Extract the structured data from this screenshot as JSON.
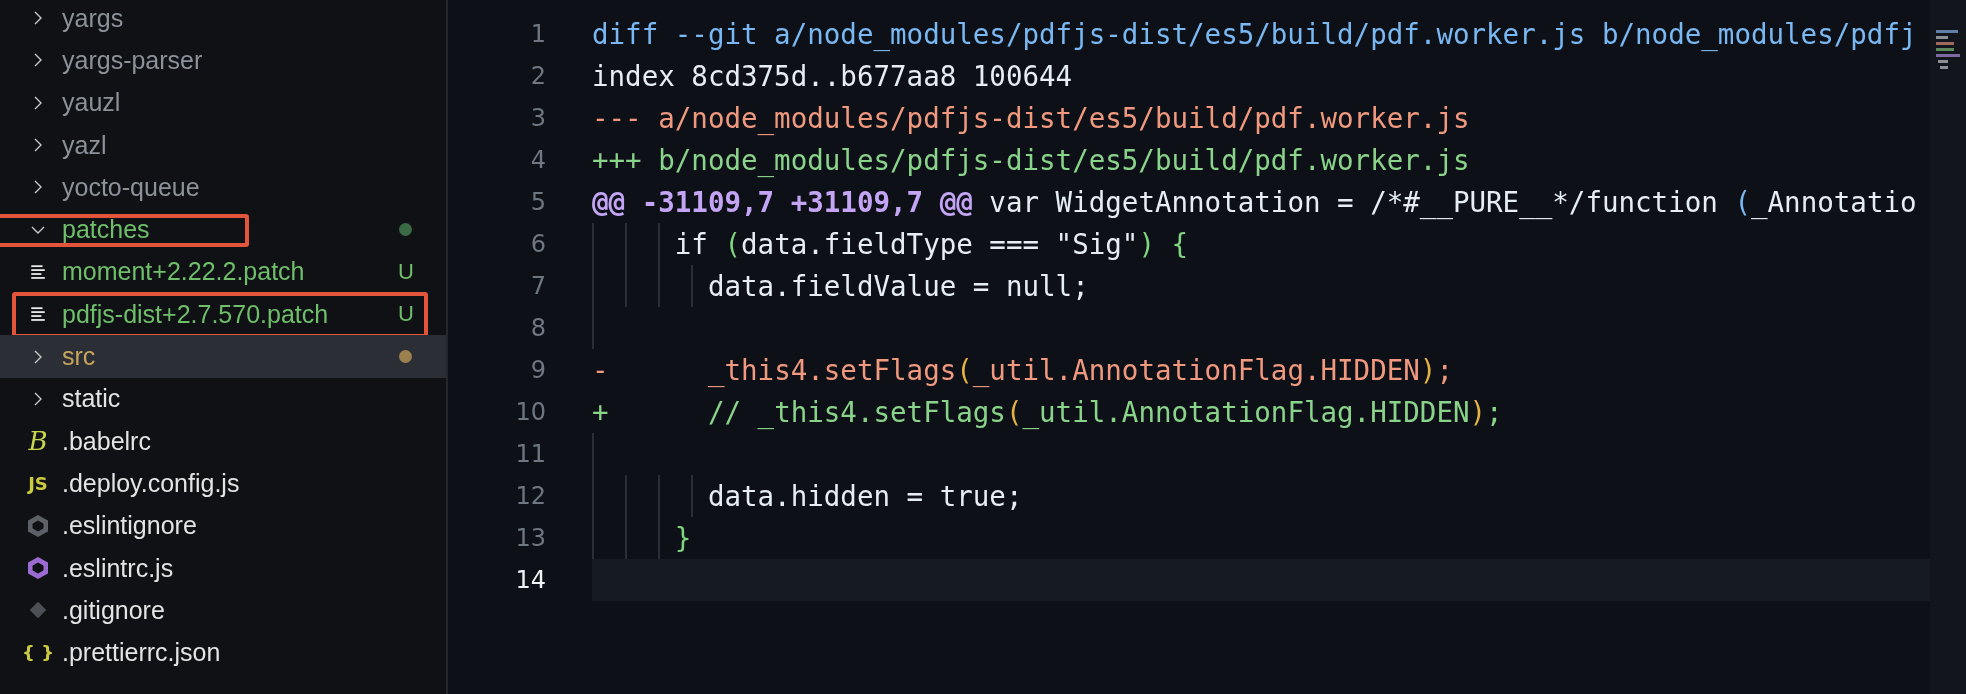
{
  "explorer": {
    "tree": [
      {
        "children": [
          {
            "label": "yargs",
            "kind": "folder",
            "expanded": false,
            "color": "#8d919a",
            "selected": false,
            "highlighted": false
          },
          {
            "label": "yargs-parser",
            "kind": "folder",
            "expanded": false,
            "color": "#8d919a",
            "selected": false,
            "highlighted": false
          },
          {
            "label": "yauzl",
            "kind": "folder",
            "expanded": false,
            "color": "#8d919a",
            "selected": false,
            "highlighted": false
          },
          {
            "label": "yazl",
            "kind": "folder",
            "expanded": false,
            "color": "#8d919a",
            "selected": false,
            "highlighted": false
          },
          {
            "label": "yocto-queue",
            "kind": "folder",
            "expanded": false,
            "color": "#8d919a",
            "selected": false,
            "highlighted": false
          }
        ]
      },
      {
        "label": "patches",
        "kind": "folder",
        "expanded": true,
        "color": "#6fbf6a",
        "dot": {
          "color": "#3b6b45"
        },
        "selected": false,
        "highlighted": true,
        "children": [
          {
            "label": "moment+2.22.2.patch",
            "kind": "file",
            "icon": {
              "kind": "lines"
            },
            "color": "#6fbf6a",
            "badge": "U",
            "selected": false,
            "highlighted": false
          },
          {
            "label": "pdfjs-dist+2.7.570.patch",
            "kind": "file",
            "icon": {
              "kind": "lines"
            },
            "color": "#6fbf6a",
            "badge": "U",
            "selected": false,
            "highlighted": true
          }
        ]
      },
      {
        "label": "src",
        "kind": "folder",
        "expanded": false,
        "color": "#c9a55c",
        "dot": {
          "color": "#9c8050"
        },
        "selected": true,
        "highlighted": false
      },
      {
        "label": "static",
        "kind": "folder",
        "expanded": false,
        "color": "#e4e4e4",
        "selected": false,
        "highlighted": false
      },
      {
        "label": ".babelrc",
        "kind": "file",
        "icon": {
          "kind": "glyph",
          "text": "B"
        },
        "color": "#e4e4e4",
        "selected": false,
        "highlighted": false
      },
      {
        "label": ".deploy.config.js",
        "kind": "file",
        "icon": {
          "kind": "glyph",
          "text": "JS"
        },
        "color": "#e4e4e4",
        "selected": false,
        "highlighted": false
      },
      {
        "label": ".eslintignore",
        "kind": "file",
        "icon": {
          "kind": "hexagon",
          "color": "#5d6167"
        },
        "color": "#e4e4e4",
        "selected": false,
        "highlighted": false
      },
      {
        "label": ".eslintrc.js",
        "kind": "file",
        "icon": {
          "kind": "hexagon",
          "color": "#9a6bd0"
        },
        "color": "#e4e4e4",
        "selected": false,
        "highlighted": false
      },
      {
        "label": ".gitignore",
        "kind": "file",
        "icon": {
          "kind": "diamond"
        },
        "color": "#e4e4e4",
        "selected": false,
        "highlighted": false
      },
      {
        "label": ".prettierrc.json",
        "kind": "file",
        "icon": {
          "kind": "glyph",
          "text": "{ }"
        },
        "color": "#e4e4e4",
        "selected": false,
        "highlighted": false
      }
    ]
  },
  "editor": {
    "lines": [
      {
        "number": "1",
        "kind": "header",
        "current": false,
        "segments": [
          {
            "text": "diff --git a/node_modules/pdfjs-dist/es5/build/pdf.worker.js b/node_modules/pdfj",
            "kind": "plain"
          }
        ]
      },
      {
        "number": "2",
        "kind": "index",
        "current": false,
        "segments": [
          {
            "text": "index 8cd375d..b677aa8 100644",
            "kind": "plain"
          }
        ]
      },
      {
        "number": "3",
        "kind": "del-file",
        "current": false,
        "segments": [
          {
            "text": "--- a/node_modules/pdfjs-dist/es5/build/pdf.worker.js",
            "kind": "plain"
          }
        ]
      },
      {
        "number": "4",
        "kind": "add-file",
        "current": false,
        "segments": [
          {
            "text": "+++ b/node_modules/pdfjs-dist/es5/build/pdf.worker.js",
            "kind": "plain"
          }
        ]
      },
      {
        "number": "5",
        "kind": "context",
        "current": false,
        "segments": [
          {
            "text": "@@ -31109,7 +31109,7 @@",
            "kind": "hunk"
          },
          {
            "text": " var WidgetAnnotation = /*#__PURE__*/function ",
            "kind": "plain"
          },
          {
            "text": "(",
            "kind": "bracket-b"
          },
          {
            "text": "_Annotatio",
            "kind": "plain"
          }
        ]
      },
      {
        "number": "6",
        "kind": "context",
        "current": false,
        "segments": [
          {
            "text": "     if ",
            "kind": "plain"
          },
          {
            "text": "(",
            "kind": "bracket-g"
          },
          {
            "text": "data.fieldType === \"Sig\"",
            "kind": "plain"
          },
          {
            "text": ") {",
            "kind": "bracket-g"
          }
        ]
      },
      {
        "number": "7",
        "kind": "context",
        "current": false,
        "segments": [
          {
            "text": "       data.fieldValue = null;",
            "kind": "plain"
          }
        ]
      },
      {
        "number": "8",
        "kind": "empty",
        "current": false
      },
      {
        "number": "9",
        "kind": "deleted",
        "marker": "-",
        "current": false,
        "segments": [
          {
            "text": "      _this4.setFlags",
            "kind": "plain"
          },
          {
            "text": "(",
            "kind": "bracket-y"
          },
          {
            "text": "_util.AnnotationFlag.HIDDEN",
            "kind": "plain"
          },
          {
            "text": ")",
            "kind": "bracket-y"
          },
          {
            "text": ";",
            "kind": "plain"
          }
        ]
      },
      {
        "number": "10",
        "kind": "added",
        "marker": "+",
        "current": false,
        "segments": [
          {
            "text": "      // _this4.setFlags",
            "kind": "plain"
          },
          {
            "text": "(",
            "kind": "bracket-y"
          },
          {
            "text": "_util.AnnotationFlag.HIDDEN",
            "kind": "plain"
          },
          {
            "text": ")",
            "kind": "bracket-y"
          },
          {
            "text": ";",
            "kind": "plain"
          }
        ]
      },
      {
        "number": "11",
        "kind": "empty",
        "current": false
      },
      {
        "number": "12",
        "kind": "context",
        "current": false,
        "segments": [
          {
            "text": "       data.hidden = true;",
            "kind": "plain"
          }
        ]
      },
      {
        "number": "13",
        "kind": "context",
        "current": false,
        "segments": [
          {
            "text": "     }",
            "kind": "bracket-g"
          }
        ]
      },
      {
        "number": "14",
        "kind": "empty",
        "current": true
      }
    ]
  }
}
